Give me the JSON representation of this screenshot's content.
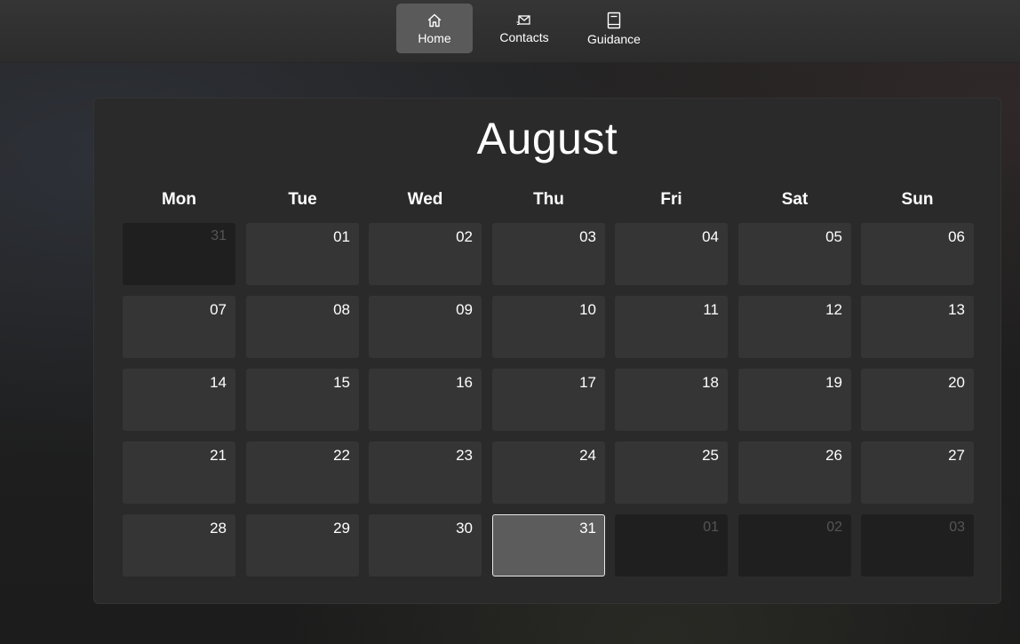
{
  "nav": {
    "items": [
      {
        "label": "Home",
        "icon": "home-icon",
        "active": true
      },
      {
        "label": "Contacts",
        "icon": "mail-icon",
        "active": false
      },
      {
        "label": "Guidance",
        "icon": "book-icon",
        "active": false
      }
    ]
  },
  "calendar": {
    "month": "August",
    "weekdays": [
      "Mon",
      "Tue",
      "Wed",
      "Thu",
      "Fri",
      "Sat",
      "Sun"
    ],
    "weeks": [
      [
        {
          "label": "31",
          "other": true
        },
        {
          "label": "01"
        },
        {
          "label": "02"
        },
        {
          "label": "03"
        },
        {
          "label": "04"
        },
        {
          "label": "05"
        },
        {
          "label": "06"
        }
      ],
      [
        {
          "label": "07"
        },
        {
          "label": "08"
        },
        {
          "label": "09"
        },
        {
          "label": "10"
        },
        {
          "label": "11"
        },
        {
          "label": "12"
        },
        {
          "label": "13"
        }
      ],
      [
        {
          "label": "14"
        },
        {
          "label": "15"
        },
        {
          "label": "16"
        },
        {
          "label": "17"
        },
        {
          "label": "18"
        },
        {
          "label": "19"
        },
        {
          "label": "20"
        }
      ],
      [
        {
          "label": "21"
        },
        {
          "label": "22"
        },
        {
          "label": "23"
        },
        {
          "label": "24"
        },
        {
          "label": "25"
        },
        {
          "label": "26"
        },
        {
          "label": "27"
        }
      ],
      [
        {
          "label": "28"
        },
        {
          "label": "29"
        },
        {
          "label": "30"
        },
        {
          "label": "31",
          "today": true
        },
        {
          "label": "01",
          "other": true
        },
        {
          "label": "02",
          "other": true
        },
        {
          "label": "03",
          "other": true
        }
      ]
    ]
  },
  "colors": {
    "background": "#1e1e1e",
    "panel": "#2a2a2a",
    "day_cell": "#353535",
    "other_month_cell": "#1f1f1f",
    "selected_cell": "#5c5c5c",
    "active_nav": "#5a5a5a"
  }
}
